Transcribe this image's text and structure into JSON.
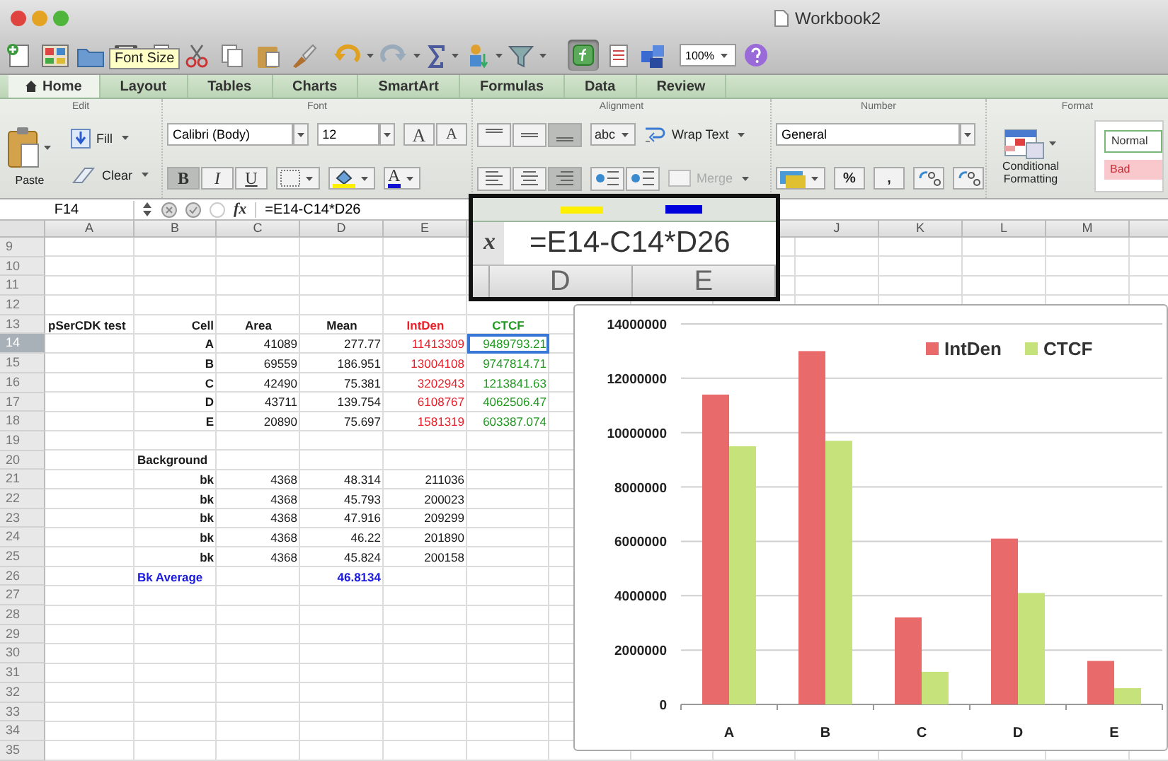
{
  "window": {
    "title": "Workbook2"
  },
  "toolbar": {
    "zoom": "100%",
    "tooltip": "Font Size",
    "formula_builder_on": true
  },
  "ribbon": {
    "tabs": [
      {
        "label": "Home",
        "selected": true
      },
      {
        "label": "Layout",
        "selected": false
      },
      {
        "label": "Tables",
        "selected": false
      },
      {
        "label": "Charts",
        "selected": false
      },
      {
        "label": "SmartArt",
        "selected": false
      },
      {
        "label": "Formulas",
        "selected": false
      },
      {
        "label": "Data",
        "selected": false
      },
      {
        "label": "Review",
        "selected": false
      }
    ],
    "groups": [
      "Edit",
      "Font",
      "Alignment",
      "Number",
      "Format"
    ],
    "edit": {
      "paste": "Paste",
      "fill": "Fill",
      "clear": "Clear"
    },
    "font": {
      "name": "Calibri (Body)",
      "size": "12",
      "grow": "A",
      "shrink": "A",
      "font_color": "A",
      "styles": [
        {
          "label": "B",
          "pressed": true
        },
        {
          "label": "I",
          "pressed": false
        },
        {
          "label": "U",
          "pressed": false
        }
      ]
    },
    "alignment": {
      "vertical": [
        {
          "pressed": false
        },
        {
          "pressed": false
        },
        {
          "pressed": true
        }
      ],
      "horizontal": [
        {
          "pressed": false
        },
        {
          "pressed": false
        },
        {
          "pressed": true
        }
      ],
      "orientation": "abc",
      "wrap": "Wrap Text",
      "merge": {
        "label": "Merge",
        "disabled": true
      }
    },
    "number": {
      "format": "General",
      "percent": "%",
      "comma": ","
    },
    "format": {
      "conditional": "Conditional Formatting",
      "styles": [
        {
          "label": "Normal",
          "kind": "normal"
        },
        {
          "label": "Bad",
          "kind": "bad"
        }
      ]
    }
  },
  "formula_bar": {
    "cell": "F14",
    "function_label": "fx",
    "formula": "=E14-C14*D26"
  },
  "sheet": {
    "columns": [
      "A",
      "B",
      "C",
      "D",
      "E",
      "J",
      "K",
      "L",
      "M"
    ],
    "rows": [
      {
        "number": "9",
        "selected": false
      },
      {
        "number": "10",
        "selected": false
      },
      {
        "number": "11",
        "selected": false
      },
      {
        "number": "12",
        "selected": false
      },
      {
        "number": "13",
        "selected": false,
        "cells": {
          "A": {
            "text": "pSerCDK test",
            "kind": "title",
            "color": "#1a1a1a",
            "selected": false
          },
          "B": {
            "text": "Cell",
            "kind": "key",
            "color": "#1a1a1a",
            "selected": false
          },
          "C": {
            "text": "Area",
            "kind": "header",
            "color": "#1a1a1a",
            "selected": false
          },
          "D": {
            "text": "Mean",
            "kind": "header",
            "color": "#1a1a1a",
            "selected": false
          },
          "E": {
            "text": "IntDen",
            "kind": "header",
            "color": "#e8202a",
            "selected": false
          },
          "F": {
            "text": "CTCF",
            "kind": "header",
            "color": "#1f9a1f",
            "selected": false
          }
        }
      },
      {
        "number": "14",
        "selected": true,
        "cells": {
          "B": {
            "text": "A",
            "kind": "key",
            "color": "#1a1a1a",
            "selected": false
          },
          "C": {
            "text": "41089",
            "kind": "value",
            "color": "#1a1a1a",
            "selected": false
          },
          "D": {
            "text": "277.77",
            "kind": "value",
            "color": "#1a1a1a",
            "selected": false
          },
          "E": {
            "text": "11413309",
            "kind": "value",
            "color": "#e8202a",
            "selected": false
          },
          "F": {
            "text": "9489793.21",
            "kind": "value",
            "color": "#1f9a1f",
            "selected": true
          }
        }
      },
      {
        "number": "15",
        "selected": false,
        "cells": {
          "B": {
            "text": "B",
            "kind": "key",
            "color": "#1a1a1a",
            "selected": false
          },
          "C": {
            "text": "69559",
            "kind": "value",
            "color": "#1a1a1a",
            "selected": false
          },
          "D": {
            "text": "186.951",
            "kind": "value",
            "color": "#1a1a1a",
            "selected": false
          },
          "E": {
            "text": "13004108",
            "kind": "value",
            "color": "#e8202a",
            "selected": false
          },
          "F": {
            "text": "9747814.71",
            "kind": "value",
            "color": "#1f9a1f",
            "selected": false
          }
        }
      },
      {
        "number": "16",
        "selected": false,
        "cells": {
          "B": {
            "text": "C",
            "kind": "key",
            "color": "#1a1a1a",
            "selected": false
          },
          "C": {
            "text": "42490",
            "kind": "value",
            "color": "#1a1a1a",
            "selected": false
          },
          "D": {
            "text": "75.381",
            "kind": "value",
            "color": "#1a1a1a",
            "selected": false
          },
          "E": {
            "text": "3202943",
            "kind": "value",
            "color": "#e8202a",
            "selected": false
          },
          "F": {
            "text": "1213841.63",
            "kind": "value",
            "color": "#1f9a1f",
            "selected": false
          }
        }
      },
      {
        "number": "17",
        "selected": false,
        "cells": {
          "B": {
            "text": "D",
            "kind": "key",
            "color": "#1a1a1a",
            "selected": false
          },
          "C": {
            "text": "43711",
            "kind": "value",
            "color": "#1a1a1a",
            "selected": false
          },
          "D": {
            "text": "139.754",
            "kind": "value",
            "color": "#1a1a1a",
            "selected": false
          },
          "E": {
            "text": "6108767",
            "kind": "value",
            "color": "#e8202a",
            "selected": false
          },
          "F": {
            "text": "4062506.47",
            "kind": "value",
            "color": "#1f9a1f",
            "selected": false
          }
        }
      },
      {
        "number": "18",
        "selected": false,
        "cells": {
          "B": {
            "text": "E",
            "kind": "key",
            "color": "#1a1a1a",
            "selected": false
          },
          "C": {
            "text": "20890",
            "kind": "value",
            "color": "#1a1a1a",
            "selected": false
          },
          "D": {
            "text": "75.697",
            "kind": "value",
            "color": "#1a1a1a",
            "selected": false
          },
          "E": {
            "text": "1581319",
            "kind": "value",
            "color": "#e8202a",
            "selected": false
          },
          "F": {
            "text": "603387.074",
            "kind": "value",
            "color": "#1f9a1f",
            "selected": false
          }
        }
      },
      {
        "number": "19",
        "selected": false
      },
      {
        "number": "20",
        "selected": false,
        "cells": {
          "B": {
            "text": "Background",
            "kind": "title",
            "color": "#1a1a1a",
            "selected": false
          }
        }
      },
      {
        "number": "21",
        "selected": false,
        "cells": {
          "B": {
            "text": "bk",
            "kind": "key",
            "color": "#1a1a1a",
            "selected": false
          },
          "C": {
            "text": "4368",
            "kind": "value",
            "color": "#1a1a1a",
            "selected": false
          },
          "D": {
            "text": "48.314",
            "kind": "value",
            "color": "#1a1a1a",
            "selected": false
          },
          "E": {
            "text": "211036",
            "kind": "value",
            "color": "#1a1a1a",
            "selected": false
          }
        }
      },
      {
        "number": "22",
        "selected": false,
        "cells": {
          "B": {
            "text": "bk",
            "kind": "key",
            "color": "#1a1a1a",
            "selected": false
          },
          "C": {
            "text": "4368",
            "kind": "value",
            "color": "#1a1a1a",
            "selected": false
          },
          "D": {
            "text": "45.793",
            "kind": "value",
            "color": "#1a1a1a",
            "selected": false
          },
          "E": {
            "text": "200023",
            "kind": "value",
            "color": "#1a1a1a",
            "selected": false
          }
        }
      },
      {
        "number": "23",
        "selected": false,
        "cells": {
          "B": {
            "text": "bk",
            "kind": "key",
            "color": "#1a1a1a",
            "selected": false
          },
          "C": {
            "text": "4368",
            "kind": "value",
            "color": "#1a1a1a",
            "selected": false
          },
          "D": {
            "text": "47.916",
            "kind": "value",
            "color": "#1a1a1a",
            "selected": false
          },
          "E": {
            "text": "209299",
            "kind": "value",
            "color": "#1a1a1a",
            "selected": false
          }
        }
      },
      {
        "number": "24",
        "selected": false,
        "cells": {
          "B": {
            "text": "bk",
            "kind": "key",
            "color": "#1a1a1a",
            "selected": false
          },
          "C": {
            "text": "4368",
            "kind": "value",
            "color": "#1a1a1a",
            "selected": false
          },
          "D": {
            "text": "46.22",
            "kind": "value",
            "color": "#1a1a1a",
            "selected": false
          },
          "E": {
            "text": "201890",
            "kind": "value",
            "color": "#1a1a1a",
            "selected": false
          }
        }
      },
      {
        "number": "25",
        "selected": false,
        "cells": {
          "B": {
            "text": "bk",
            "kind": "key",
            "color": "#1a1a1a",
            "selected": false
          },
          "C": {
            "text": "4368",
            "kind": "value",
            "color": "#1a1a1a",
            "selected": false
          },
          "D": {
            "text": "45.824",
            "kind": "value",
            "color": "#1a1a1a",
            "selected": false
          },
          "E": {
            "text": "200158",
            "kind": "value",
            "color": "#1a1a1a",
            "selected": false
          }
        }
      },
      {
        "number": "26",
        "selected": false,
        "cells": {
          "B": {
            "text": "Bk Average",
            "kind": "title",
            "color": "#1a1ae0",
            "selected": false
          },
          "D": {
            "text": "46.8134",
            "kind": "result",
            "color": "#1a1ae0",
            "selected": false
          }
        }
      },
      {
        "number": "27",
        "selected": false
      },
      {
        "number": "28",
        "selected": false
      },
      {
        "number": "29",
        "selected": false
      },
      {
        "number": "30",
        "selected": false
      },
      {
        "number": "31",
        "selected": false
      },
      {
        "number": "32",
        "selected": false
      },
      {
        "number": "33",
        "selected": false
      },
      {
        "number": "34",
        "selected": false
      },
      {
        "number": "35",
        "selected": false
      }
    ]
  },
  "magnifier": {
    "function_label": "x",
    "formula": "=E14-C14*D26",
    "columns": [
      "D",
      "E"
    ]
  },
  "chart": {
    "chart_data": {
      "type": "bar",
      "categories": [
        "A",
        "B",
        "C",
        "D",
        "E"
      ],
      "series": [
        {
          "name": "IntDen",
          "color": "#e96a6a",
          "values": [
            11400000,
            13000000,
            3200000,
            6100000,
            1600000
          ]
        },
        {
          "name": "CTCF",
          "color": "#c5e37a",
          "values": [
            9500000,
            9700000,
            1200000,
            4100000,
            600000
          ]
        }
      ],
      "grid": true,
      "legend": true,
      "ylim": [
        0,
        14000000
      ],
      "yticks": [
        0,
        2000000,
        4000000,
        6000000,
        8000000,
        10000000,
        12000000,
        14000000
      ]
    }
  }
}
